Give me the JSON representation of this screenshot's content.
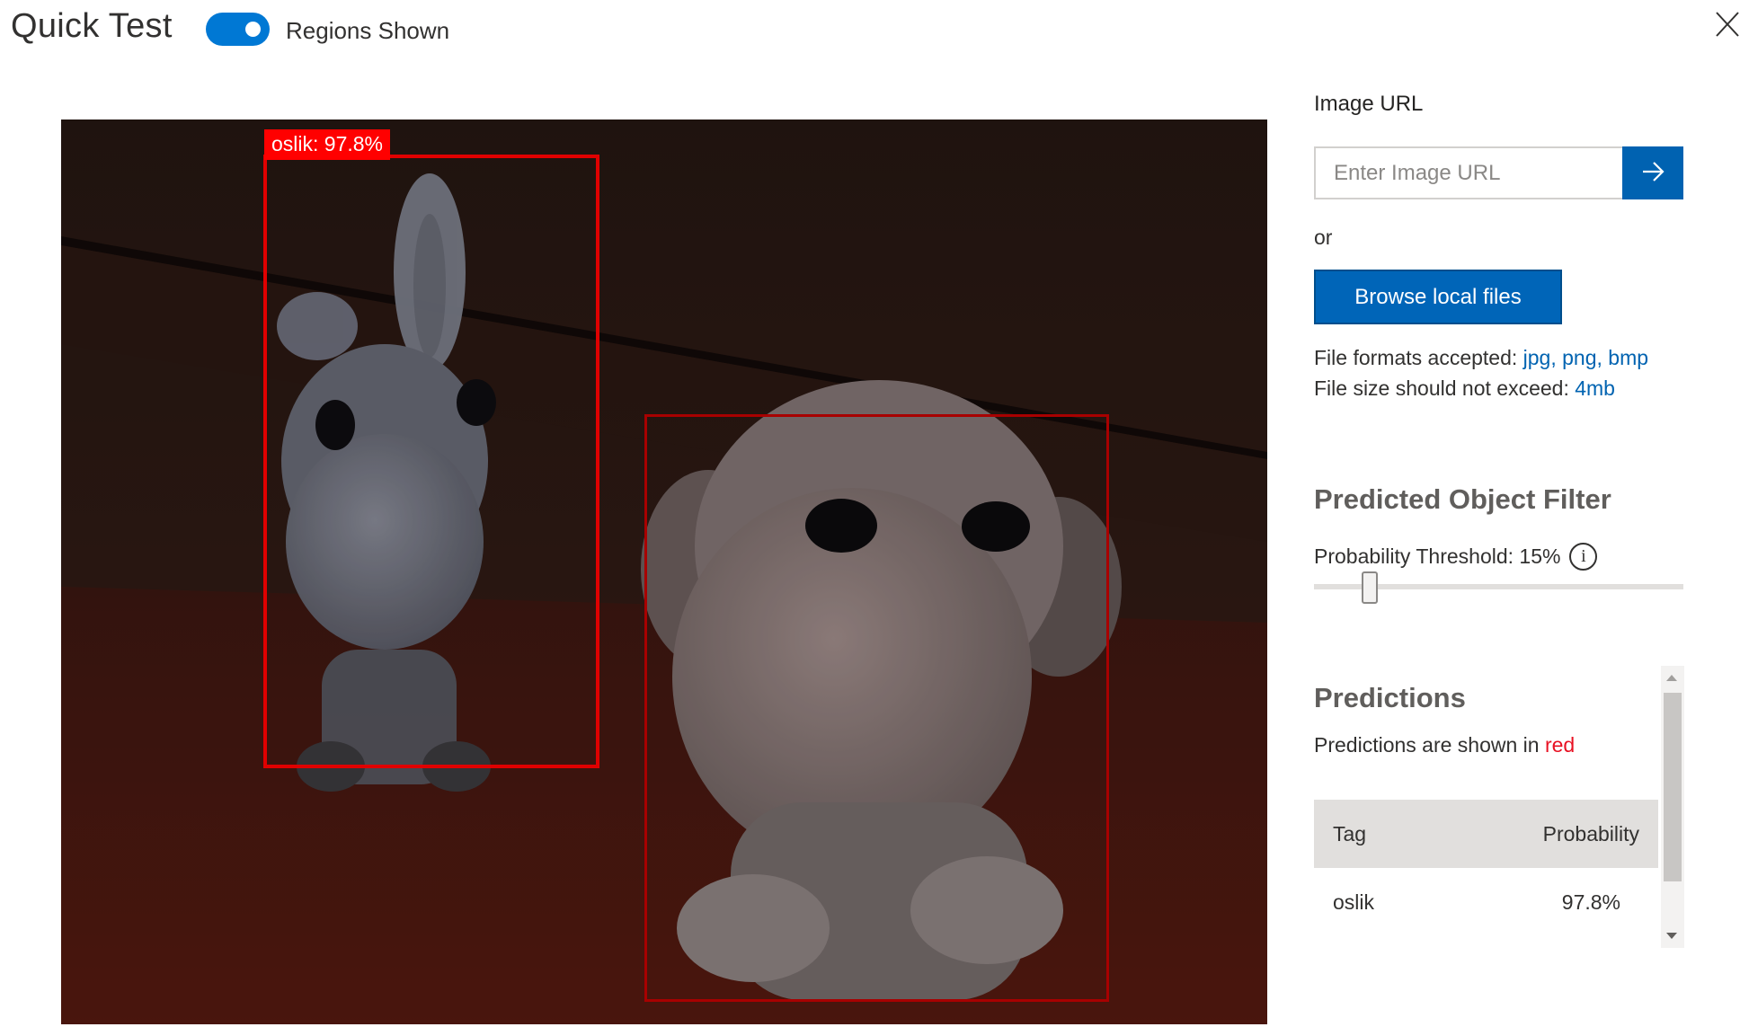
{
  "header": {
    "title": "Quick Test",
    "toggle_label": "Regions Shown",
    "toggle_on": true,
    "close_icon": "close-icon"
  },
  "image": {
    "regions": [
      {
        "label": "oslik: 97.8%",
        "tag": "oslik",
        "probability": "97.8%"
      },
      {
        "label": "",
        "tag": "",
        "probability": ""
      }
    ]
  },
  "url_section": {
    "label": "Image URL",
    "placeholder": "Enter Image URL",
    "submit_icon": "arrow-right-icon",
    "or_text": "or",
    "browse_label": "Browse local files"
  },
  "file_info": {
    "formats_prefix": "File formats accepted:",
    "formats": [
      "jpg,",
      "png,",
      "bmp"
    ],
    "size_prefix": "File size should not exceed:",
    "size_limit": "4mb"
  },
  "filter": {
    "heading": "Predicted Object Filter",
    "threshold_label": "Probability Threshold: 15%",
    "info_icon": "info-icon",
    "threshold_value": 0.15
  },
  "predictions": {
    "heading": "Predictions",
    "subtitle_prefix": "Predictions are shown in",
    "subtitle_color_word": "red",
    "columns": [
      "Tag",
      "Probability"
    ],
    "rows": [
      {
        "tag": "oslik",
        "probability": "97.8%"
      }
    ]
  },
  "colors": {
    "accent": "#0078d4",
    "button": "#0065b8",
    "link": "#0063b1",
    "region": "#ff0000"
  }
}
